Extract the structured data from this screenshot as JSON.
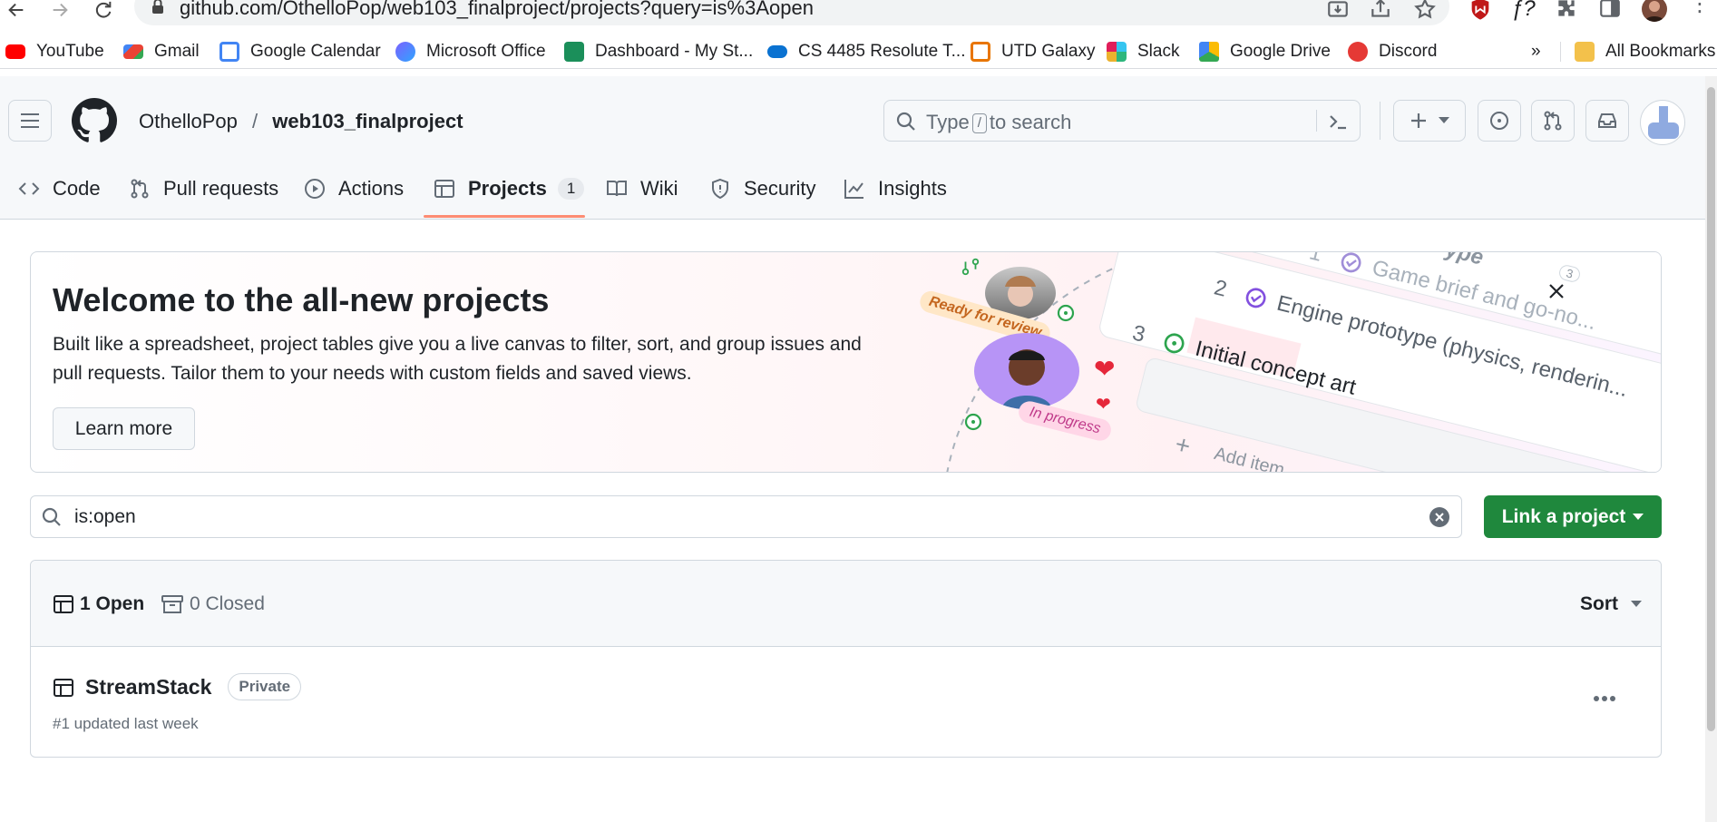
{
  "browser": {
    "url": "github.com/OthelloPop/web103_finalproject/projects?query=is%3Aopen",
    "bookmarks": [
      {
        "label": "YouTube",
        "icon": "youtube-icon",
        "color": "#ff0000"
      },
      {
        "label": "Gmail",
        "icon": "gmail-icon",
        "color": "#ea4335"
      },
      {
        "label": "Google Calendar",
        "icon": "calendar-icon",
        "color": "#4285f4"
      },
      {
        "label": "Microsoft Office",
        "icon": "office-icon",
        "color": "#7b61ff"
      },
      {
        "label": "Dashboard - My St...",
        "icon": "dashboard-icon",
        "color": "#1b8f5a"
      },
      {
        "label": "CS 4485 Resolute T...",
        "icon": "onedrive-icon",
        "color": "#0a72d1"
      },
      {
        "label": "UTD Galaxy",
        "icon": "utd-icon",
        "color": "#e87500"
      },
      {
        "label": "Slack",
        "icon": "slack-icon",
        "color": "#e01e5a"
      },
      {
        "label": "Google Drive",
        "icon": "drive-icon",
        "color": "#34a853"
      },
      {
        "label": "Discord",
        "icon": "discord-icon",
        "color": "#e53935"
      }
    ],
    "overflow": "»",
    "all_bookmarks": "All Bookmarks"
  },
  "header": {
    "owner": "OthelloPop",
    "separator": "/",
    "repo": "web103_finalproject",
    "search_pre": "Type",
    "search_key": "/",
    "search_post": "to search"
  },
  "tabs": [
    {
      "label": "Code",
      "icon": "code-icon"
    },
    {
      "label": "Pull requests",
      "icon": "pull-request-icon"
    },
    {
      "label": "Actions",
      "icon": "play-icon"
    },
    {
      "label": "Projects",
      "icon": "table-icon",
      "counter": "1",
      "selected": true
    },
    {
      "label": "Wiki",
      "icon": "book-icon"
    },
    {
      "label": "Security",
      "icon": "shield-icon"
    },
    {
      "label": "Insights",
      "icon": "graph-icon"
    }
  ],
  "banner": {
    "title": "Welcome to the all-new projects",
    "body": "Built like a spreadsheet, project tables give you a live canvas to filter, sort, and group issues and pull requests. Tailor them to your needs with custom fields and saved views.",
    "button": "Learn more",
    "art": {
      "ready_label": "Ready for review",
      "progress_label": "In progress",
      "rows": [
        {
          "num": "1",
          "text": "Game brief and go-no..."
        },
        {
          "num": "2",
          "text": "Engine prototype (physics, renderin..."
        },
        {
          "num": "3",
          "text": "Initial concept art"
        }
      ],
      "add_item": "Add item",
      "partial_header": "ype",
      "count": "3"
    }
  },
  "filter": {
    "value": "is:open"
  },
  "link_button": "Link a project",
  "list": {
    "open_label": "1 Open",
    "closed_label": "0 Closed",
    "sort_label": "Sort",
    "items": [
      {
        "title": "StreamStack",
        "badge": "Private",
        "meta": "#1 updated last week"
      }
    ]
  },
  "colors": {
    "accent_tab": "#fd8c73",
    "primary_button": "#1f883d"
  }
}
